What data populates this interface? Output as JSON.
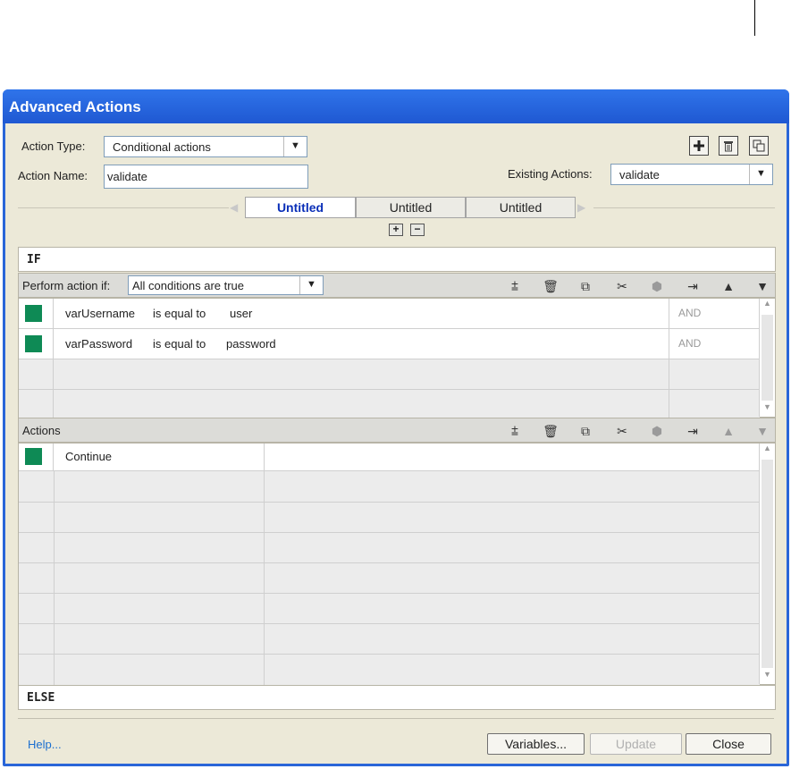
{
  "window": {
    "title": "Advanced Actions"
  },
  "action_type": {
    "label": "Action Type:",
    "value": "Conditional actions"
  },
  "action_name": {
    "label": "Action Name:",
    "value": "validate"
  },
  "existing_actions": {
    "label": "Existing Actions:",
    "value": "validate"
  },
  "tabs": [
    {
      "label": "Untitled",
      "active": true
    },
    {
      "label": "Untitled",
      "active": false
    },
    {
      "label": "Untitled",
      "active": false
    }
  ],
  "if_section": {
    "header": "IF",
    "perform_label": "Perform action if:",
    "perform_value": "All conditions are true",
    "conditions": [
      {
        "variable": "varUsername",
        "operator": "is equal to",
        "value": "user",
        "logic": "AND"
      },
      {
        "variable": "varPassword",
        "operator": "is equal to",
        "value": "password",
        "logic": "AND"
      }
    ]
  },
  "actions_section": {
    "header": "Actions",
    "items": [
      {
        "label": "Continue"
      }
    ]
  },
  "else_header": "ELSE",
  "footer": {
    "help": "Help...",
    "variables": "Variables...",
    "update": "Update",
    "close": "Close"
  },
  "colors": {
    "titlebar": "#2a66d8",
    "row_marker": "#0e8a55",
    "active_tab": "#0a2fb8"
  }
}
